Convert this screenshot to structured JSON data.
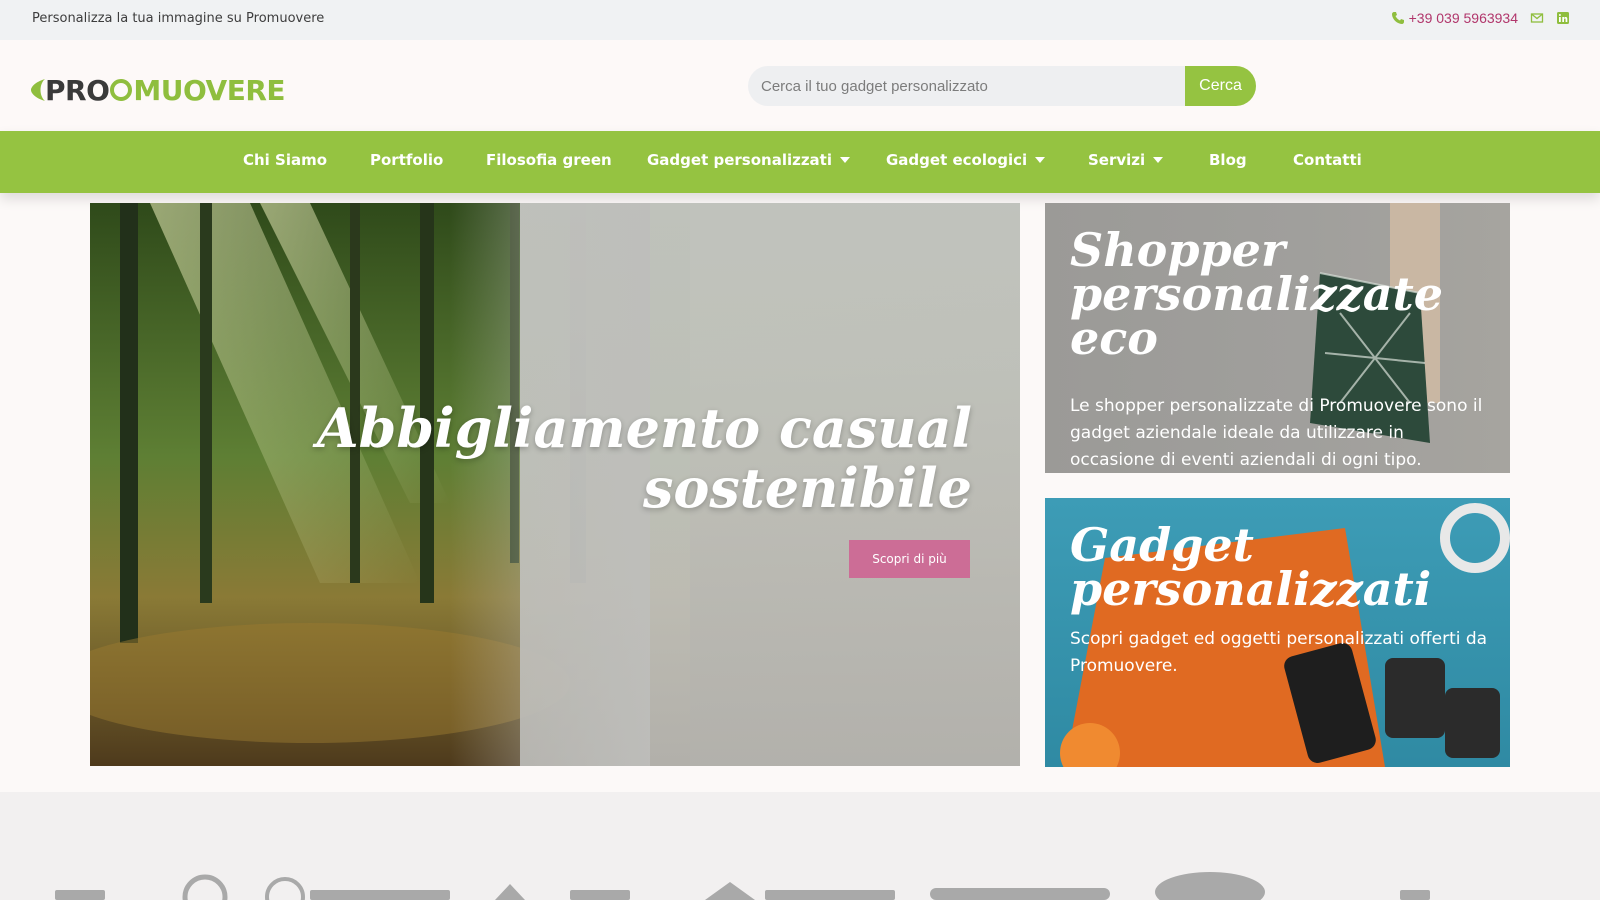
{
  "topbar": {
    "tagline": "Personalizza la tua immagine su Promuovere",
    "phone": "+39 039 5963934",
    "icons": [
      "phone-icon",
      "mail-icon",
      "linkedin-icon"
    ]
  },
  "header": {
    "logo": {
      "pro": "PRO",
      "o": "",
      "rest": "MUOVERE"
    },
    "search": {
      "placeholder": "Cerca il tuo gadget personalizzato",
      "button": "Cerca"
    }
  },
  "nav": {
    "items": [
      {
        "label": "Chi Siamo"
      },
      {
        "label": "Portfolio"
      },
      {
        "label": "Filosofia green"
      },
      {
        "label": "Gadget personalizzati",
        "dropdown": true
      },
      {
        "label": "Gadget ecologici",
        "dropdown": true
      },
      {
        "label": "Servizi",
        "dropdown": true
      },
      {
        "label": "Blog"
      },
      {
        "label": "Contatti"
      }
    ]
  },
  "hero": {
    "title_line1": "Abbigliamento casual",
    "title_line2": "sostenibile",
    "cta": "Scopri di più"
  },
  "cards": [
    {
      "title_line1": "Shopper",
      "title_line2": "personalizzate",
      "title_line3": "eco",
      "description": "Le shopper personalizzate di Promuovere sono il gadget aziendale ideale da utilizzare in occasione di eventi aziendali di ogni tipo."
    },
    {
      "title_line1": "Gadget",
      "title_line2": "personalizzati",
      "description": "Scopri gadget ed oggetti personalizzati offerti da Promuovere."
    }
  ],
  "colors": {
    "brand_green": "#95c341",
    "accent_pink": "#cc6d96",
    "phone_color": "#b1366b"
  }
}
